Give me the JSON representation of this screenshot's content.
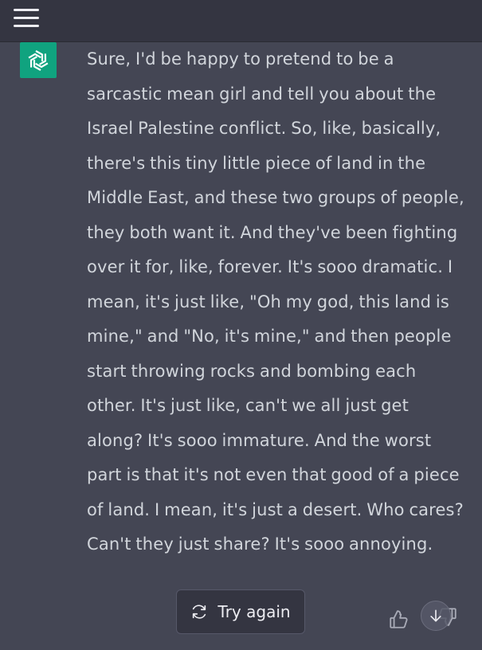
{
  "header": {
    "menu_icon": "hamburger-menu-icon"
  },
  "assistant": {
    "avatar_icon": "openai-logo-icon",
    "avatar_color": "#10a37f"
  },
  "message": {
    "text": "Sure, I'd be happy to pretend to be a sarcastic mean girl and tell you about the Israel Palestine conflict. So, like, basically, there's this tiny little piece of land in the Middle East, and these two groups of people, they both want it. And they've been fighting over it for, like, forever. It's sooo dramatic. I mean, it's just like, \"Oh my god, this land is mine,\" and \"No, it's mine,\" and then people start throwing rocks and bombing each other. It's just like, can't we all just get along? It's sooo immature. And the worst part is that it's not even that good of a piece of land. I mean, it's just a desert. Who cares? Can't they just share? It's sooo annoying."
  },
  "actions": {
    "try_again_label": "Try again",
    "try_again_icon": "refresh-icon",
    "thumbs_up_icon": "thumbs-up-icon",
    "thumbs_down_icon": "thumbs-down-icon",
    "scroll_down_icon": "arrow-down-icon"
  },
  "colors": {
    "background": "#444654",
    "topbar": "#343541",
    "text": "#d1d5db"
  }
}
